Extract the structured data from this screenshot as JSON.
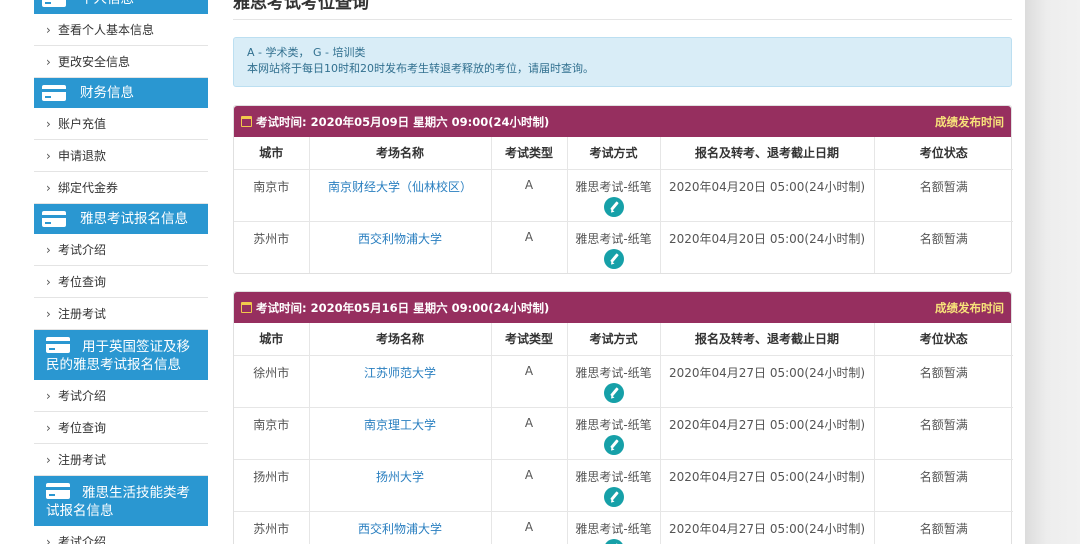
{
  "sidebar": {
    "sections": [
      {
        "title": "个人信息",
        "items": [
          "查看个人基本信息",
          "更改安全信息"
        ]
      },
      {
        "title": "财务信息",
        "items": [
          "账户充值",
          "申请退款",
          "绑定代金券"
        ]
      },
      {
        "title": "雅思考试报名信息",
        "items": [
          "考试介绍",
          "考位查询",
          "注册考试"
        ]
      },
      {
        "title": "用于英国签证及移民的雅思考试报名信息",
        "items": [
          "考试介绍",
          "考位查询",
          "注册考试"
        ]
      },
      {
        "title": "雅思生活技能类考试报名信息",
        "items": [
          "考试介绍"
        ]
      }
    ]
  },
  "main": {
    "title": "雅思考试考位查询",
    "info_line1": "A - 学术类， G - 培训类",
    "info_line2": "本网站将于每日10时和20时发布考生转退考释放的考位，请届时查询。"
  },
  "table_headers": [
    "城市",
    "考场名称",
    "考试类型",
    "考试方式",
    "报名及转考、退考截止日期",
    "考位状态"
  ],
  "panels": [
    {
      "exam_time": "考试时间: 2020年05月09日 星期六 09:00(24小时制)",
      "result_link": "成绩发布时间",
      "rows": [
        {
          "city": "南京市",
          "venue": "南京财经大学（仙林校区）",
          "type": "A",
          "mode": "雅思考试-纸笔",
          "deadline": "2020年04月20日 05:00(24小时制)",
          "status": "名额暂满"
        },
        {
          "city": "苏州市",
          "venue": "西交利物浦大学",
          "type": "A",
          "mode": "雅思考试-纸笔",
          "deadline": "2020年04月20日 05:00(24小时制)",
          "status": "名额暂满"
        }
      ]
    },
    {
      "exam_time": "考试时间: 2020年05月16日 星期六 09:00(24小时制)",
      "result_link": "成绩发布时间",
      "rows": [
        {
          "city": "徐州市",
          "venue": "江苏师范大学",
          "type": "A",
          "mode": "雅思考试-纸笔",
          "deadline": "2020年04月27日 05:00(24小时制)",
          "status": "名额暂满"
        },
        {
          "city": "南京市",
          "venue": "南京理工大学",
          "type": "A",
          "mode": "雅思考试-纸笔",
          "deadline": "2020年04月27日 05:00(24小时制)",
          "status": "名额暂满"
        },
        {
          "city": "扬州市",
          "venue": "扬州大学",
          "type": "A",
          "mode": "雅思考试-纸笔",
          "deadline": "2020年04月27日 05:00(24小时制)",
          "status": "名额暂满"
        },
        {
          "city": "苏州市",
          "venue": "西交利物浦大学",
          "type": "A",
          "mode": "雅思考试-纸笔",
          "deadline": "2020年04月27日 05:00(24小时制)",
          "status": "名额暂满"
        }
      ]
    }
  ],
  "colors": {
    "sidebar_header": "#2a97d1",
    "panel_header": "#962f5f",
    "result_link": "#f7e27a",
    "info_bg": "#d9edf7",
    "edit_icon": "#16a0a8"
  },
  "icons": {
    "section": "card-icon",
    "item": "chevron-right-icon",
    "panel": "calendar-icon",
    "row_action": "pencil-icon"
  }
}
